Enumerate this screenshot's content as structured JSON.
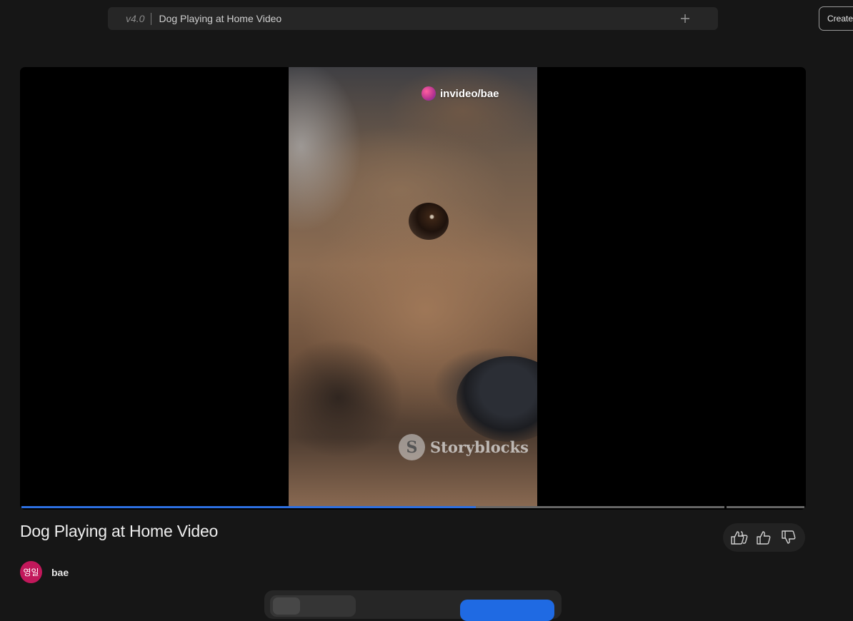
{
  "topbar": {
    "version": "v4.0",
    "title": "Dog Playing at Home Video",
    "add_icon": "plus-icon"
  },
  "create_button": {
    "label": "Create"
  },
  "player": {
    "watermark_top": "invideo/bae",
    "watermark_bottom": "Storyblocks",
    "watermark_bottom_glyph": "S",
    "progress_fraction": 0.58,
    "progress_color": "#2d6fe0"
  },
  "video": {
    "title": "Dog Playing at Home Video"
  },
  "feedback": {
    "icons": [
      "double-thumbs-up-icon",
      "thumbs-up-icon",
      "thumbs-down-icon"
    ]
  },
  "author": {
    "avatar_text": "영일",
    "name": "bae",
    "avatar_color": "#c2185b"
  }
}
